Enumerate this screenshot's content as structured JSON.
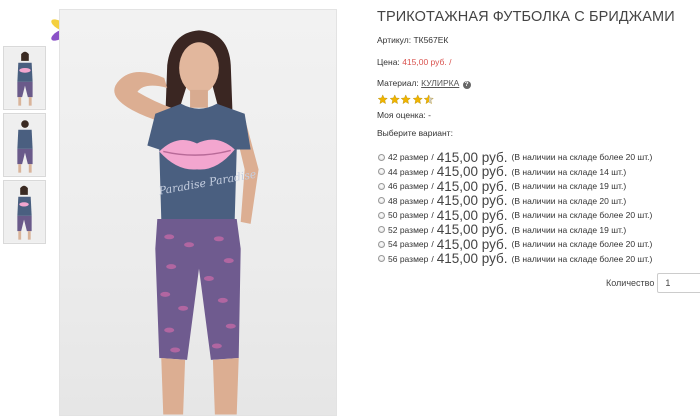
{
  "product": {
    "title": "ТРИКОТАЖНАЯ ФУТБОЛКА С БРИДЖАМИ",
    "article_label": "Артикул:",
    "article_value": "ТК567ЕК",
    "price_label": "Цена:",
    "price_value": "415,00 руб.",
    "price_suffix": "/",
    "material_label": "Материал:",
    "material_value": "КУЛИРКА",
    "help_icon_text": "?",
    "rating": 4.5,
    "rating_max": 5,
    "my_rating_label": "Моя оценка:",
    "my_rating_value": "-",
    "choose_variant_label": "Выберите вариант:"
  },
  "variants": [
    {
      "size": "42 размер",
      "price": "415,00 руб.",
      "stock": "(В наличии на складе более 20 шт.)"
    },
    {
      "size": "44 размер",
      "price": "415,00 руб.",
      "stock": "(В наличии на складе 14 шт.)"
    },
    {
      "size": "46 размер",
      "price": "415,00 руб.",
      "stock": "(В наличии на складе 19 шт.)"
    },
    {
      "size": "48 размер",
      "price": "415,00 руб.",
      "stock": "(В наличии на складе 20 шт.)"
    },
    {
      "size": "50 размер",
      "price": "415,00 руб.",
      "stock": "(В наличии на складе более 20 шт.)"
    },
    {
      "size": "52 размер",
      "price": "415,00 руб.",
      "stock": "(В наличии на складе 19 шт.)"
    },
    {
      "size": "54 размер",
      "price": "415,00 руб.",
      "stock": "(В наличии на складе более 20 шт.)"
    },
    {
      "size": "56 размер",
      "price": "415,00 руб.",
      "stock": "(В наличии на складе более 20 шт.)"
    }
  ],
  "variant_separator": "/",
  "quantity": {
    "label": "Количество",
    "value": "1"
  },
  "image": {
    "shirt_print": "Paradise Paradise"
  },
  "colors": {
    "price_accent": "#d9534f",
    "star": "#f0b400",
    "shirt": "#4a5f80",
    "lips": "#f3a6cf"
  }
}
